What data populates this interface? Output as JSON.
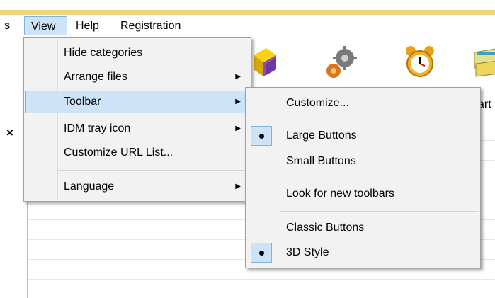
{
  "menubar": {
    "tools_partial": "s",
    "view": "View",
    "help": "Help",
    "registration": "Registration"
  },
  "toolbar": {
    "start_label_partial": "art",
    "icons": [
      "cube-icon",
      "gears-icon",
      "alarm-clock-icon",
      "start-queue-icon"
    ]
  },
  "panel": {
    "close_glyph": "×"
  },
  "view_menu": {
    "items": [
      {
        "label": "Hide categories",
        "submenu": false
      },
      {
        "label": "Arrange files",
        "submenu": true
      },
      {
        "label": "Toolbar",
        "submenu": true,
        "highlighted": true
      },
      {
        "label": "IDM tray icon",
        "submenu": true
      },
      {
        "label": "Customize URL List...",
        "submenu": false
      },
      {
        "label": "Language",
        "submenu": true
      }
    ],
    "arrow_glyph": "▶"
  },
  "toolbar_menu": {
    "items": [
      {
        "label": "Customize...",
        "checked": false
      },
      {
        "label": "Large Buttons",
        "checked": true
      },
      {
        "label": "Small Buttons",
        "checked": false
      },
      {
        "label": "Look for new toolbars",
        "checked": false
      },
      {
        "label": "Classic Buttons",
        "checked": false
      },
      {
        "label": "3D Style",
        "checked": true
      }
    ]
  },
  "colors": {
    "accent_bar": "#f2d479",
    "highlight_fill": "#cde3f8",
    "highlight_border": "#7fb2e4",
    "menu_bg": "#f2f2f2"
  }
}
